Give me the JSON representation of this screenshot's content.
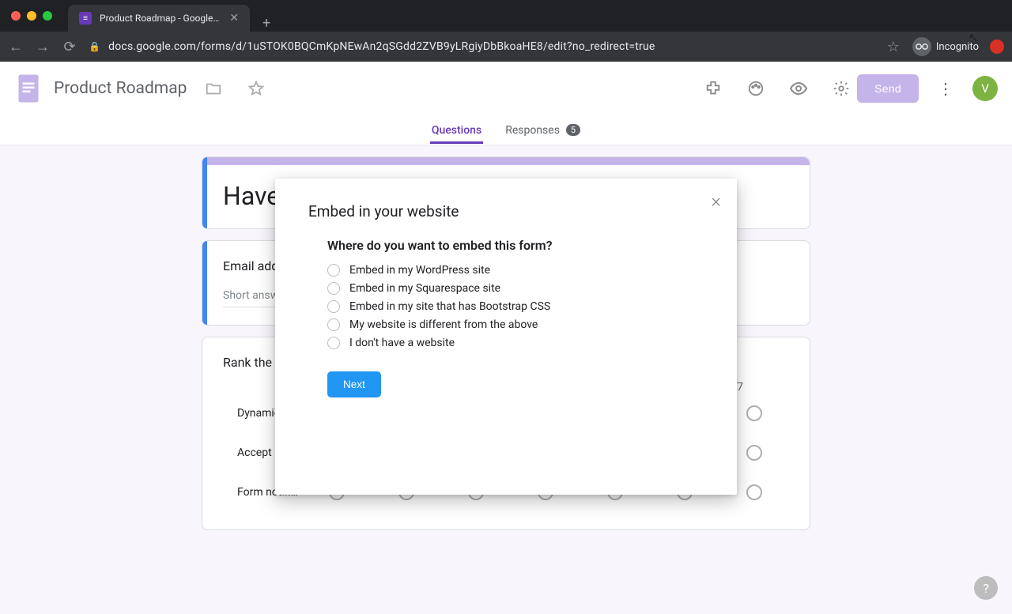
{
  "browser": {
    "tab_title": "Product Roadmap - Google Form",
    "url": "docs.google.com/forms/d/1uSTOK0BQCmKpNEwAn2qSGdd2ZVB9yLRgiyDbBkoaHE8/edit?no_redirect=true",
    "incognito_label": "Incognito"
  },
  "header": {
    "form_title": "Product Roadmap",
    "send_label": "Send",
    "avatar_letter": "V"
  },
  "tabs": {
    "questions": "Questions",
    "responses": "Responses",
    "response_count": "5"
  },
  "title_card": {
    "title": "Have"
  },
  "email_card": {
    "label": "Email add",
    "placeholder": "Short answ"
  },
  "rank_card": {
    "label": "Rank the",
    "last_col": "7",
    "rows": [
      "Dynamic th…",
      "Accept pay…",
      "Form notifi…"
    ]
  },
  "modal": {
    "title": "Embed in your website",
    "subtitle": "Where do you want to embed this form?",
    "options": [
      "Embed in my WordPress site",
      "Embed in my Squarespace site",
      "Embed in my site that has Bootstrap CSS",
      "My website is different from the above",
      "I don't have a website"
    ],
    "next": "Next"
  }
}
